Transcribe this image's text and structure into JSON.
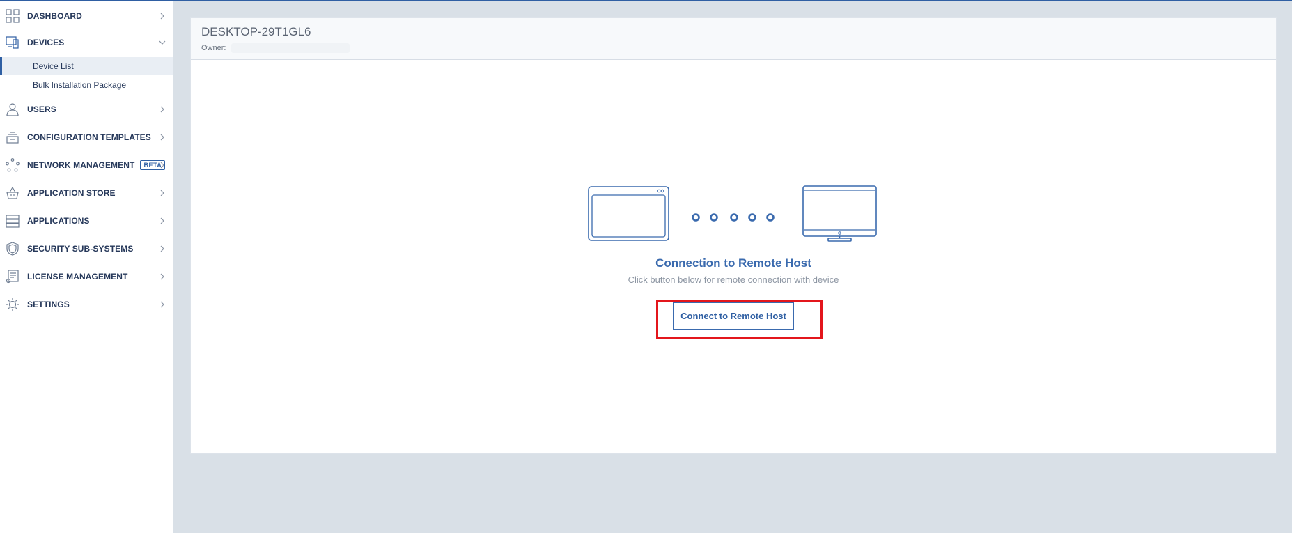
{
  "sidebar": {
    "items": [
      {
        "name": "dashboard",
        "label": "DASHBOARD",
        "icon": "grid-icon",
        "expanded": false
      },
      {
        "name": "devices",
        "label": "DEVICES",
        "icon": "devices-icon",
        "expanded": true,
        "subitems": [
          {
            "label": "Device List",
            "active": true
          },
          {
            "label": "Bulk Installation Package",
            "active": false
          }
        ]
      },
      {
        "name": "users",
        "label": "USERS",
        "icon": "user-icon",
        "expanded": false
      },
      {
        "name": "configuration-templates",
        "label": "CONFIGURATION TEMPLATES",
        "icon": "layers-icon",
        "expanded": false
      },
      {
        "name": "network-management",
        "label": "NETWORK MANAGEMENT",
        "icon": "network-icon",
        "expanded": false,
        "badge": "BETA"
      },
      {
        "name": "application-store",
        "label": "APPLICATION STORE",
        "icon": "basket-icon",
        "expanded": false
      },
      {
        "name": "applications",
        "label": "APPLICATIONS",
        "icon": "server-icon",
        "expanded": false
      },
      {
        "name": "security-sub-systems",
        "label": "SECURITY SUB-SYSTEMS",
        "icon": "shield-icon",
        "expanded": false
      },
      {
        "name": "license-management",
        "label": "LICENSE MANAGEMENT",
        "icon": "certificate-icon",
        "expanded": false
      },
      {
        "name": "settings",
        "label": "SETTINGS",
        "icon": "gear-icon",
        "expanded": false
      }
    ]
  },
  "device": {
    "title": "DESKTOP-29T1GL6",
    "owner_label": "Owner:",
    "owner_value": ""
  },
  "connection": {
    "title": "Connection to Remote Host",
    "subtitle": "Click button below for remote connection with device",
    "button_label": "Connect to Remote Host"
  },
  "colors": {
    "accent": "#2f5fa3",
    "link_blue": "#3a6aae",
    "highlight": "#e3161c",
    "background": "#d9e0e7"
  }
}
